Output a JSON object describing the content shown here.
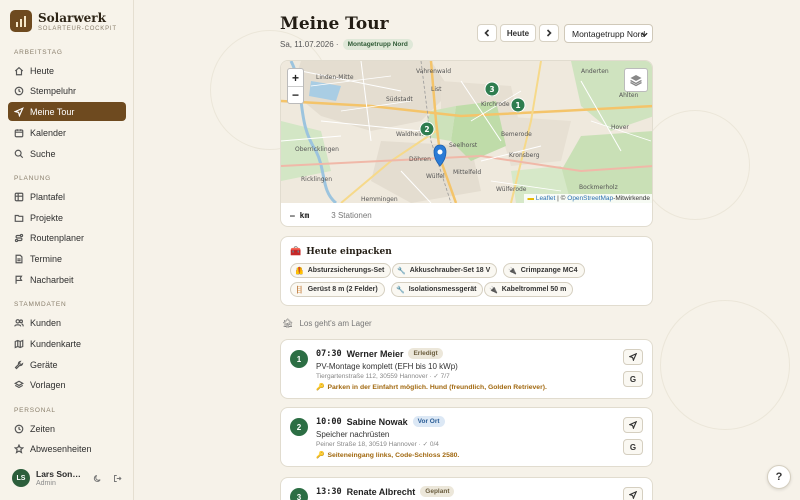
{
  "brand": {
    "name": "Solarwerk",
    "subtitle": "SOLARTEUR-COCKPIT"
  },
  "sidebar": {
    "sections": {
      "arbeitstag": "ARBEITSTAG",
      "planung": "PLANUNG",
      "stammdaten": "STAMMDATEN",
      "personal": "PERSONAL"
    },
    "items": [
      {
        "label": "Heute",
        "icon": "home-icon"
      },
      {
        "label": "Stempeluhr",
        "icon": "clock-icon"
      },
      {
        "label": "Meine Tour",
        "icon": "navigation-icon",
        "active": true
      },
      {
        "label": "Kalender",
        "icon": "calendar-icon"
      },
      {
        "label": "Suche",
        "icon": "search-icon"
      },
      {
        "label": "Plantafel",
        "icon": "grid-icon"
      },
      {
        "label": "Projekte",
        "icon": "folder-icon"
      },
      {
        "label": "Routenplaner",
        "icon": "route-icon"
      },
      {
        "label": "Termine",
        "icon": "document-icon"
      },
      {
        "label": "Nacharbeit",
        "icon": "flag-icon"
      },
      {
        "label": "Kunden",
        "icon": "users-icon"
      },
      {
        "label": "Kundenkarte",
        "icon": "map-icon"
      },
      {
        "label": "Geräte",
        "icon": "wrench-icon"
      },
      {
        "label": "Vorlagen",
        "icon": "layers-icon"
      },
      {
        "label": "Zeiten",
        "icon": "clock-icon"
      },
      {
        "label": "Abwesenheiten",
        "icon": "star-icon"
      }
    ]
  },
  "user": {
    "initials": "LS",
    "name": "Lars Sonnberg",
    "role": "Admin"
  },
  "header": {
    "title": "Meine Tour",
    "date": "Sa, 11.07.2026 ·",
    "team_badge": "Montagetrupp Nord",
    "today_button": "Heute",
    "team_select": "Montagetrupp Nord"
  },
  "map": {
    "zoom_in": "+",
    "zoom_out": "−",
    "attribution_leaflet": "Leaflet",
    "attribution_sep": " | © ",
    "attribution_osm": "OpenStreetMap",
    "attribution_rest": "-Mitwirkende",
    "place_labels": [
      "Linden-Mitte",
      "Vahrenwald",
      "List",
      "Südstadt",
      "Waldheim",
      "Kirchrode",
      "Bemerode",
      "Seelhorst",
      "Döhren",
      "Wülfel",
      "Mittelfeld",
      "Kronsberg",
      "Oberricklingen",
      "Hemmingen",
      "Hover",
      "Bockmerholz",
      "Ahlten",
      "Anderten",
      "Wülferode",
      "Ricklingen"
    ],
    "markers": [
      "1",
      "2",
      "3"
    ],
    "distance": "– km",
    "stations": "3 Stationen"
  },
  "pack": {
    "title": "Heute einpacken",
    "items": [
      {
        "label": "Absturzsicherungs-Set",
        "icon": "🦺"
      },
      {
        "label": "Akkuschrauber-Set 18 V",
        "icon": "🔧"
      },
      {
        "label": "Crimpzange MC4",
        "icon": "🔌"
      },
      {
        "label": "Gerüst 8 m (2 Felder)",
        "icon": "🪜"
      },
      {
        "label": "Isolationsmessgerät",
        "icon": "🔧"
      },
      {
        "label": "Kabeltrommel 50 m",
        "icon": "🔌"
      }
    ]
  },
  "lager_text": "Los geht's am Lager",
  "stops": [
    {
      "num": "1",
      "time": "07:30",
      "name": "Werner Meier",
      "status": "Erledigt",
      "task": "PV-Montage komplett (EFH bis 10 kWp)",
      "address": "Tiergartenstraße 112, 30559 Hannover · ✓ 7/7",
      "note": "Parken in der Einfahrt möglich. Hund (freundlich, Golden Retriever).",
      "g_label": "G"
    },
    {
      "num": "2",
      "time": "10:00",
      "name": "Sabine Nowak",
      "status": "Vor Ort",
      "task": "Speicher nachrüsten",
      "address": "Peiner Straße 18, 30519 Hannover · ✓ 0/4",
      "note": "Seiteneingang links, Code-Schloss 2580.",
      "g_label": "G"
    },
    {
      "num": "3",
      "time": "13:30",
      "name": "Renate Albrecht",
      "status": "Geplant",
      "task": "",
      "address": "",
      "note": "",
      "g_label": "G"
    }
  ],
  "help_label": "?",
  "colors": {
    "brand": "#6e4a1f",
    "green": "#2c6e44",
    "marker": "#2e7d4f",
    "location": "#2b7bd6"
  }
}
